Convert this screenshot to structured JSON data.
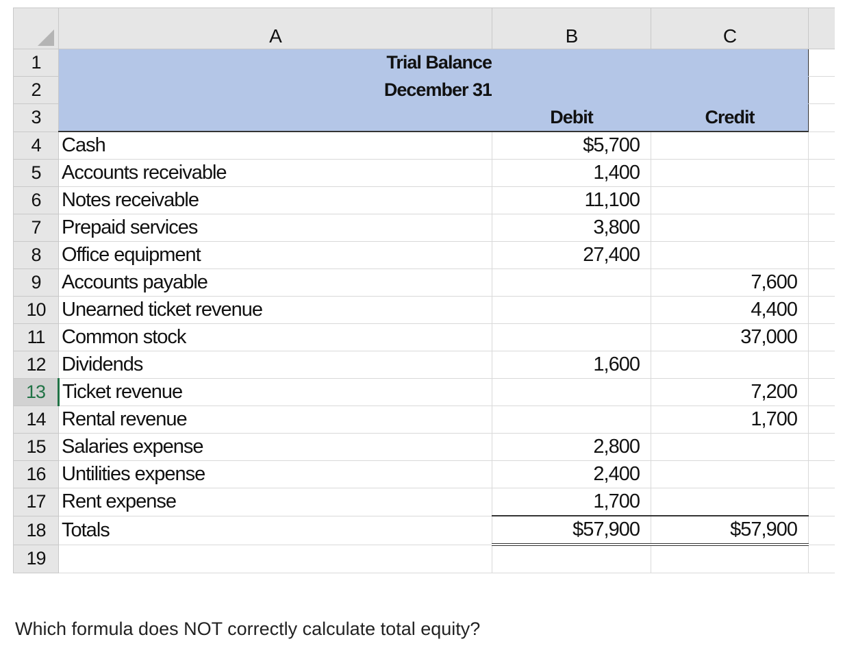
{
  "columns": [
    "A",
    "B",
    "C"
  ],
  "header": {
    "title": "Trial Balance",
    "date": "December 31",
    "debit": "Debit",
    "credit": "Credit"
  },
  "row_numbers": [
    "1",
    "2",
    "3",
    "4",
    "5",
    "6",
    "7",
    "8",
    "9",
    "10",
    "11",
    "12",
    "13",
    "14",
    "15",
    "16",
    "17",
    "18",
    "19"
  ],
  "selected_row": "13",
  "rows": [
    {
      "account": "Cash",
      "debit": "$5,700",
      "credit": ""
    },
    {
      "account": "Accounts receivable",
      "debit": "1,400",
      "credit": ""
    },
    {
      "account": "Notes receivable",
      "debit": "11,100",
      "credit": ""
    },
    {
      "account": "Prepaid services",
      "debit": "3,800",
      "credit": ""
    },
    {
      "account": "Office equipment",
      "debit": "27,400",
      "credit": ""
    },
    {
      "account": "Accounts payable",
      "debit": "",
      "credit": "7,600"
    },
    {
      "account": "Unearned ticket revenue",
      "debit": "",
      "credit": "4,400"
    },
    {
      "account": "Common stock",
      "debit": "",
      "credit": "37,000"
    },
    {
      "account": "Dividends",
      "debit": "1,600",
      "credit": ""
    },
    {
      "account": "Ticket revenue",
      "debit": "",
      "credit": "7,200"
    },
    {
      "account": "Rental revenue",
      "debit": "",
      "credit": "1,700"
    },
    {
      "account": "Salaries expense",
      "debit": "2,800",
      "credit": ""
    },
    {
      "account": "Untilities expense",
      "debit": "2,400",
      "credit": ""
    },
    {
      "account": "Rent expense",
      "debit": "1,700",
      "credit": ""
    }
  ],
  "totals": {
    "label": "Totals",
    "debit": "$57,900",
    "credit": "$57,900"
  },
  "colors": {
    "header_fill": "#b4c6e7",
    "selected_row": "#217346"
  },
  "question": "Which formula does NOT correctly calculate total equity?"
}
